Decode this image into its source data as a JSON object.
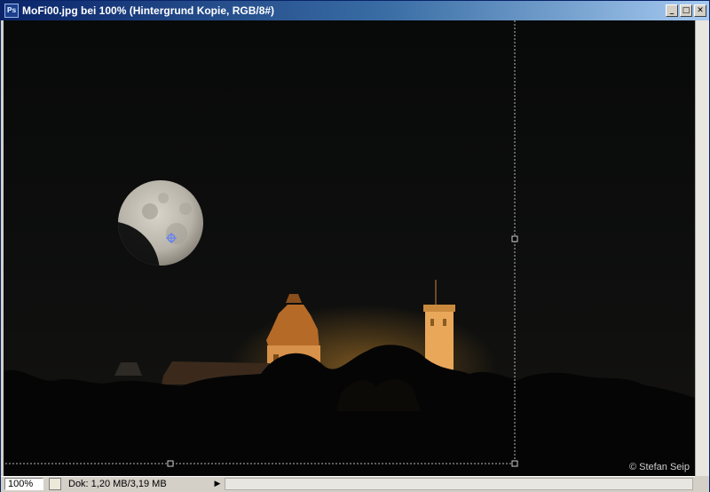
{
  "window": {
    "title": "MoFi00.jpg bei 100% (Hintergrund Kopie, RGB/8#)",
    "app_icon": "ps-icon",
    "app_icon_label": "Ps",
    "controls": {
      "minimize": "_",
      "maximize": "□",
      "close": "✕"
    }
  },
  "canvas": {
    "image_description_icon": "moon-castle-night-photo",
    "credit": "© Stefan Seip",
    "colors": {
      "sky": "#0b0c0c",
      "castle_light": "#e0a050",
      "moon": "#c9c5bb"
    }
  },
  "statusbar": {
    "zoom": "100%",
    "doc_info": "Dok: 1,20 MB/3,19 MB",
    "arrow": "▶"
  }
}
